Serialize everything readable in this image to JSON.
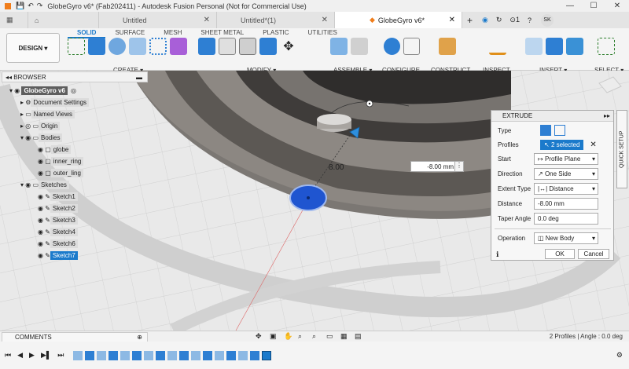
{
  "titlebar": {
    "title": "GlobeGyro v6* (Fab202411) - Autodesk Fusion Personal (Not for Commercial Use)"
  },
  "tabs": [
    {
      "label": "Untitled"
    },
    {
      "label": "Untitled*(1)"
    },
    {
      "label": "GlobeGyro v6*"
    }
  ],
  "tab_meta": {
    "notifications": "1",
    "avatar": "SK"
  },
  "toolbar": {
    "design": "DESIGN",
    "subtabs": [
      "SOLID",
      "SURFACE",
      "MESH",
      "SHEET METAL",
      "PLASTIC",
      "UTILITIES"
    ],
    "groups": [
      "CREATE",
      "MODIFY",
      "ASSEMBLE",
      "CONFIGURE",
      "CONSTRUCT",
      "INSPECT",
      "INSERT",
      "SELECT"
    ]
  },
  "browser": {
    "title": "BROWSER",
    "root": "GlobeGyro v6",
    "items": [
      {
        "label": "Document Settings"
      },
      {
        "label": "Named Views"
      },
      {
        "label": "Origin"
      },
      {
        "label": "Bodies"
      },
      {
        "label": "globe"
      },
      {
        "label": "inner_ring"
      },
      {
        "label": "outer_ling"
      },
      {
        "label": "Sketches"
      },
      {
        "label": "Sketch1"
      },
      {
        "label": "Sketch2"
      },
      {
        "label": "Sketch3"
      },
      {
        "label": "Sketch4"
      },
      {
        "label": "Sketch6"
      },
      {
        "label": "Sketch7"
      }
    ]
  },
  "viewport": {
    "dimension_label": "8.00",
    "distance_input": "-8.00 mm"
  },
  "extrude": {
    "title": "EXTRUDE",
    "rows": {
      "type": "Type",
      "profiles": "Profiles",
      "profiles_value": "2 selected",
      "start": "Start",
      "start_value": "Profile Plane",
      "direction": "Direction",
      "direction_value": "One Side",
      "extent_type": "Extent Type",
      "extent_value": "Distance",
      "distance": "Distance",
      "distance_value": "-8.00 mm",
      "taper": "Taper Angle",
      "taper_value": "0.0 deg",
      "operation": "Operation",
      "operation_value": "New Body"
    },
    "ok": "OK",
    "cancel": "Cancel"
  },
  "quick_setup": "QUICK SETUP",
  "comments": "COMMENTS",
  "status": "2 Profiles | Angle : 0.0 deg"
}
